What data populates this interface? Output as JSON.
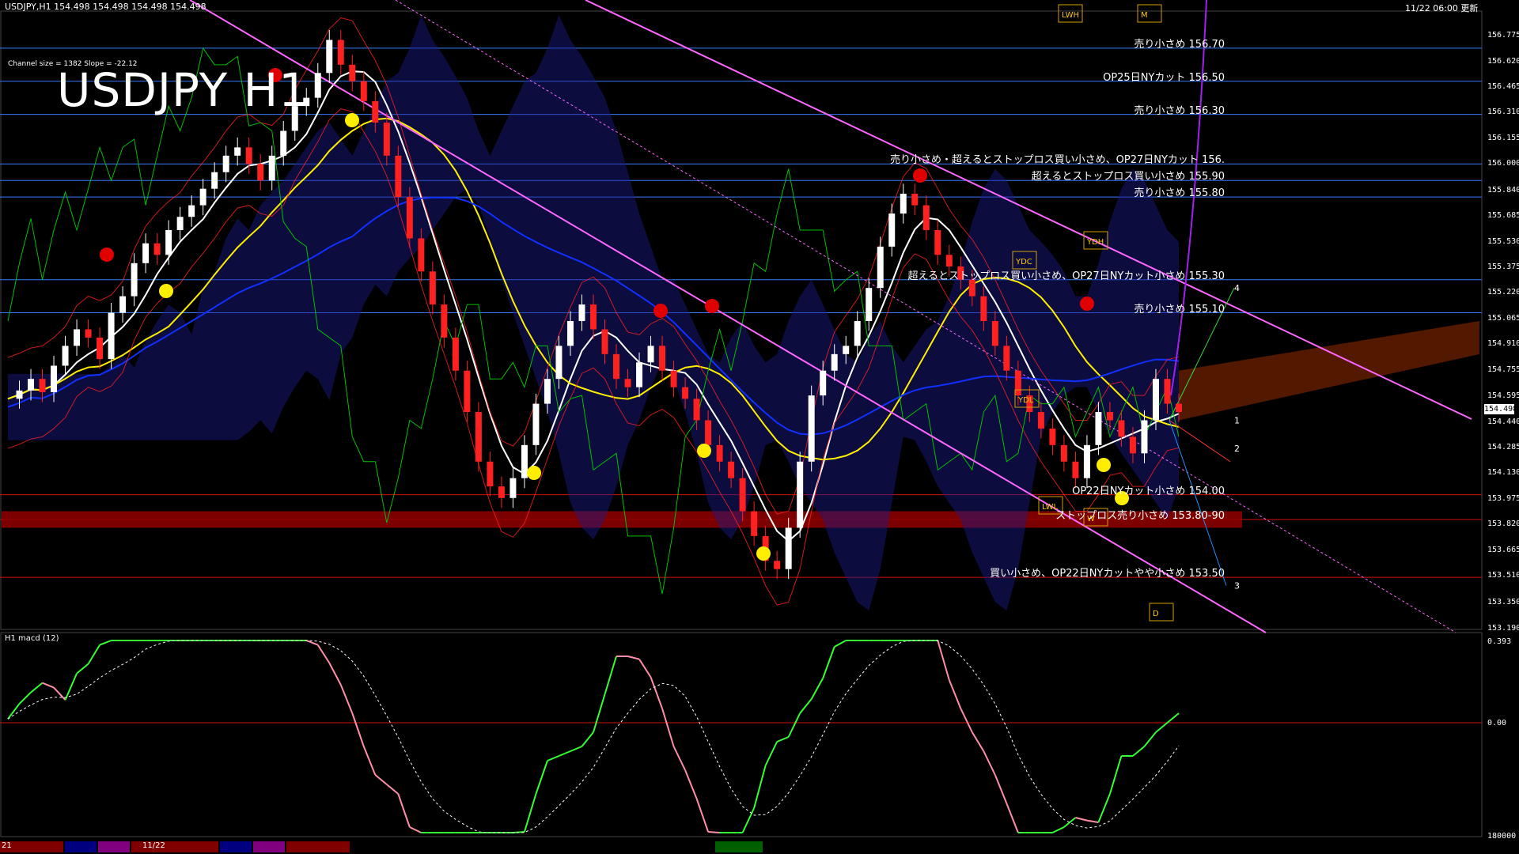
{
  "window": {
    "symbol_header": "USDJPY,H1  154.498 154.498 154.498 154.498",
    "timestamp": "11/22 06:00 更新",
    "title": "USDJPY H1",
    "channel_info": "Channel size = 1382 Slope = -22.12",
    "subwindow_label": "H1  macd (12)"
  },
  "price_axis": {
    "ticks": [
      "156.775",
      "156.620",
      "156.465",
      "156.310",
      "156.155",
      "156.000",
      "155.840",
      "155.685",
      "155.530",
      "155.375",
      "155.220",
      "155.065",
      "154.910",
      "154.755",
      "154.595",
      "154.440",
      "154.285",
      "154.130",
      "153.975",
      "153.820",
      "153.665",
      "153.510",
      "153.350",
      "153.190"
    ],
    "current_price": "154.498"
  },
  "macd_axis": {
    "ticks": [
      "0.393",
      "0.00",
      "180000"
    ]
  },
  "annotations": [
    {
      "text": "売り小さめ 156.70",
      "price": 156.7
    },
    {
      "text": "OP25日NYカット 156.50",
      "price": 156.5
    },
    {
      "text": "売り小さめ 156.30",
      "price": 156.3
    },
    {
      "text": "売り小さめ・超えるとストップロス買い小さめ、OP27日NYカット 156.",
      "price": 156.0
    },
    {
      "text": "超えるとストップロス買い小さめ 155.90",
      "price": 155.9
    },
    {
      "text": "売り小さめ 155.80",
      "price": 155.8
    },
    {
      "text": "超えるとストップロス買い小さめ、OP27日NYカット小さめ 155.30",
      "price": 155.3
    },
    {
      "text": "売り小さめ 155.10",
      "price": 155.1
    },
    {
      "text": "OP22日NYカット小さめ 154.00",
      "price": 154.0
    },
    {
      "text": "ストップロス売り小さめ 153.80-90",
      "price": 153.85
    },
    {
      "text": "買い小さめ、OP22日NYカットやや小さめ 153.50",
      "price": 153.5
    }
  ],
  "channel_labels": [
    "1",
    "2",
    "3",
    "4"
  ],
  "markers": [
    "LWH",
    "M",
    "YDH",
    "YDC",
    "YDL",
    "W",
    "D",
    "LWL"
  ],
  "date_tab": "11/22",
  "date_tab_left": "21",
  "colors": {
    "up_candle": "#ffffff",
    "down_candle": "#ff2020",
    "level_line": "#3b7bff",
    "red_level": "#d01010",
    "ma_white": "#ffffff",
    "ma_yellow": "#ffee00",
    "ma_blue": "#1030ff",
    "ma_green": "#00c000",
    "channel": "#ff66ff",
    "macd_line": "#33ff33",
    "macd_neg": "#ff8fa8",
    "signal": "#ffffff"
  },
  "chart_data": {
    "type": "candlestick",
    "title": "USDJPY H1",
    "ylim": [
      153.19,
      156.8
    ],
    "series": [
      {
        "name": "candles",
        "values": [
          154.58,
          154.63,
          154.7,
          154.62,
          154.78,
          154.9,
          155.0,
          154.95,
          154.82,
          155.1,
          155.2,
          155.4,
          155.52,
          155.45,
          155.6,
          155.68,
          155.75,
          155.85,
          155.95,
          156.05,
          156.1,
          156.0,
          155.9,
          156.05,
          156.2,
          156.35,
          156.4,
          156.55,
          156.75,
          156.6,
          156.5,
          156.38,
          156.25,
          156.05,
          155.8,
          155.55,
          155.35,
          155.15,
          154.95,
          154.75,
          154.5,
          154.2,
          154.05,
          153.98,
          154.1,
          154.3,
          154.55,
          154.7,
          154.9,
          155.05,
          155.15,
          155.0,
          154.85,
          154.7,
          154.65,
          154.8,
          154.9,
          154.75,
          154.65,
          154.58,
          154.45,
          154.3,
          154.2,
          154.1,
          153.9,
          153.75,
          153.6,
          153.55,
          153.8,
          154.2,
          154.6,
          154.75,
          154.85,
          154.9,
          155.05,
          155.25,
          155.5,
          155.7,
          155.82,
          155.75,
          155.6,
          155.45,
          155.38,
          155.3,
          155.2,
          155.05,
          154.9,
          154.75,
          154.6,
          154.5,
          154.4,
          154.3,
          154.2,
          154.1,
          154.3,
          154.5,
          154.45,
          154.35,
          154.25,
          154.45,
          154.7,
          154.55,
          154.5
        ]
      }
    ]
  }
}
